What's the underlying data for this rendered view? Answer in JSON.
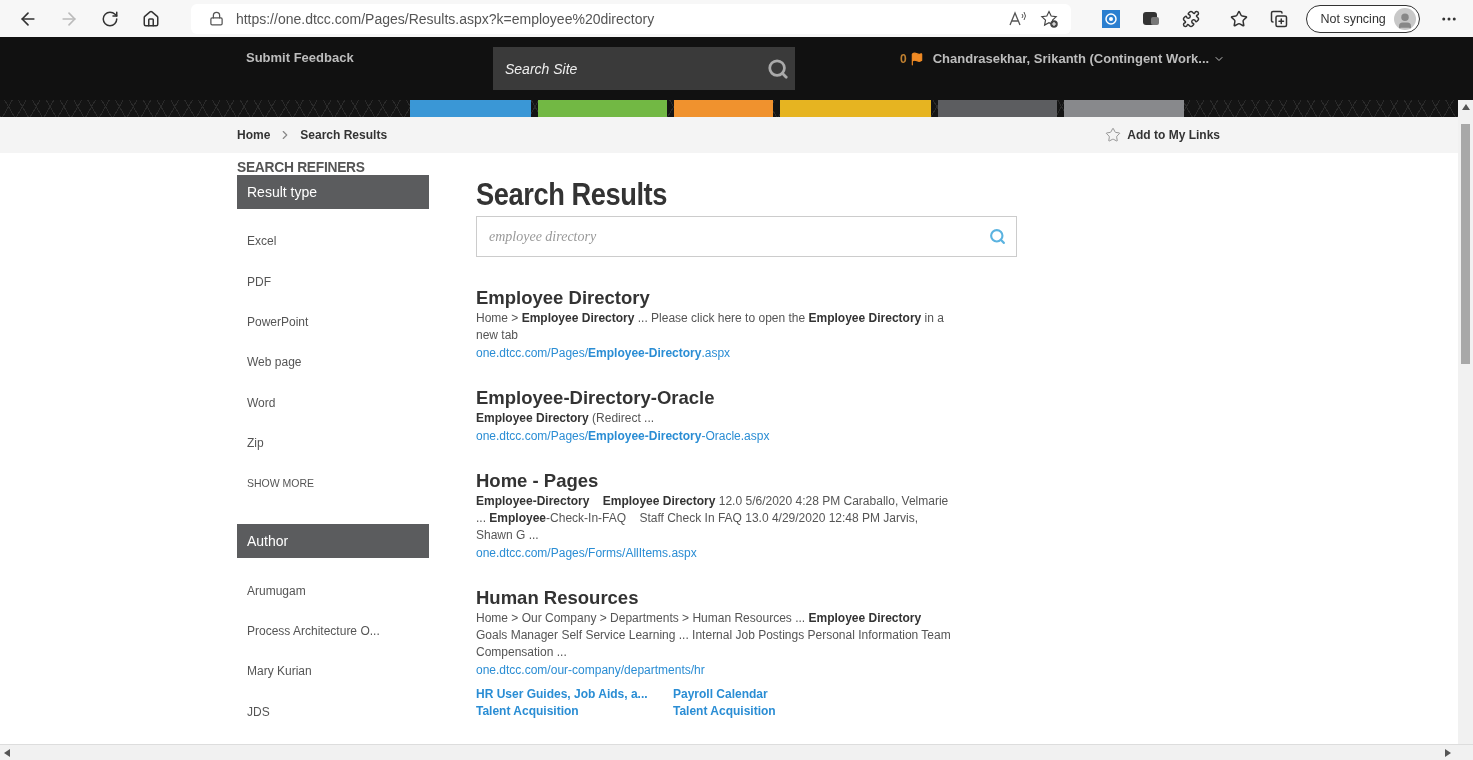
{
  "browser": {
    "url": "https://one.dtcc.com/Pages/Results.aspx?k=employee%20directory",
    "sync_label": "Not syncing"
  },
  "header": {
    "feedback": "Submit Feedback",
    "search_placeholder": "Search Site",
    "flag_count": "0",
    "user": "Chandrasekhar, Srikanth (Contingent Work..."
  },
  "nav_tabs": [
    {
      "color": "#3a97d6"
    },
    {
      "color": "#72b844"
    },
    {
      "color": "#f0922e"
    },
    {
      "color": "#e6b421"
    },
    {
      "color": "#5c5d60"
    },
    {
      "color": "#88898c"
    }
  ],
  "breadcrumb": [
    "Home",
    "Search Results"
  ],
  "add_link": "Add to My Links",
  "refiners": {
    "title": "SEARCH REFINERS",
    "groups": [
      {
        "title": "Result type",
        "items": [
          "Excel",
          "PDF",
          "PowerPoint",
          "Web page",
          "Word",
          "Zip"
        ],
        "more": "SHOW MORE"
      },
      {
        "title": "Author",
        "items": [
          "Arumugam",
          "Process Architecture O...",
          "Mary Kurian",
          "JDS"
        ]
      }
    ]
  },
  "results": {
    "title": "Search Results",
    "query": "employee directory",
    "items": [
      {
        "title": "Employee Directory",
        "snippet": "Home > **Employee Directory** ... Please click here to open the **Employee Directory** in a new tab",
        "url": "one.dtcc.com/Pages/**Employee-Directory**.aspx"
      },
      {
        "title": "Employee-Directory-Oracle",
        "snippet": "**Employee Directory** (Redirect ...",
        "url": "one.dtcc.com/Pages/**Employee-Directory**-Oracle.aspx"
      },
      {
        "title": "Home - Pages",
        "snippet": "**Employee-Directory**    **Employee Directory** 12.0 5/6/2020 4:28 PM Caraballo, Velmarie ... **Employee**-Check-In-FAQ    Staff Check In FAQ 13.0 4/29/2020 12:48 PM Jarvis, Shawn G ...",
        "url": "one.dtcc.com/Pages/Forms/AllItems.aspx"
      },
      {
        "title": "Human Resources",
        "snippet": "Home > Our Company > Departments > Human Resources ... **Employee Directory** Goals Manager Self Service Learning ... Internal Job Postings Personal Information Team Compensation ...",
        "url": "one.dtcc.com/our-company/departments/hr",
        "deep_links": [
          "HR User Guides, Job Aids, a...",
          "Payroll Calendar",
          "Talent Acquisition",
          "Talent Acquisition"
        ]
      }
    ]
  }
}
